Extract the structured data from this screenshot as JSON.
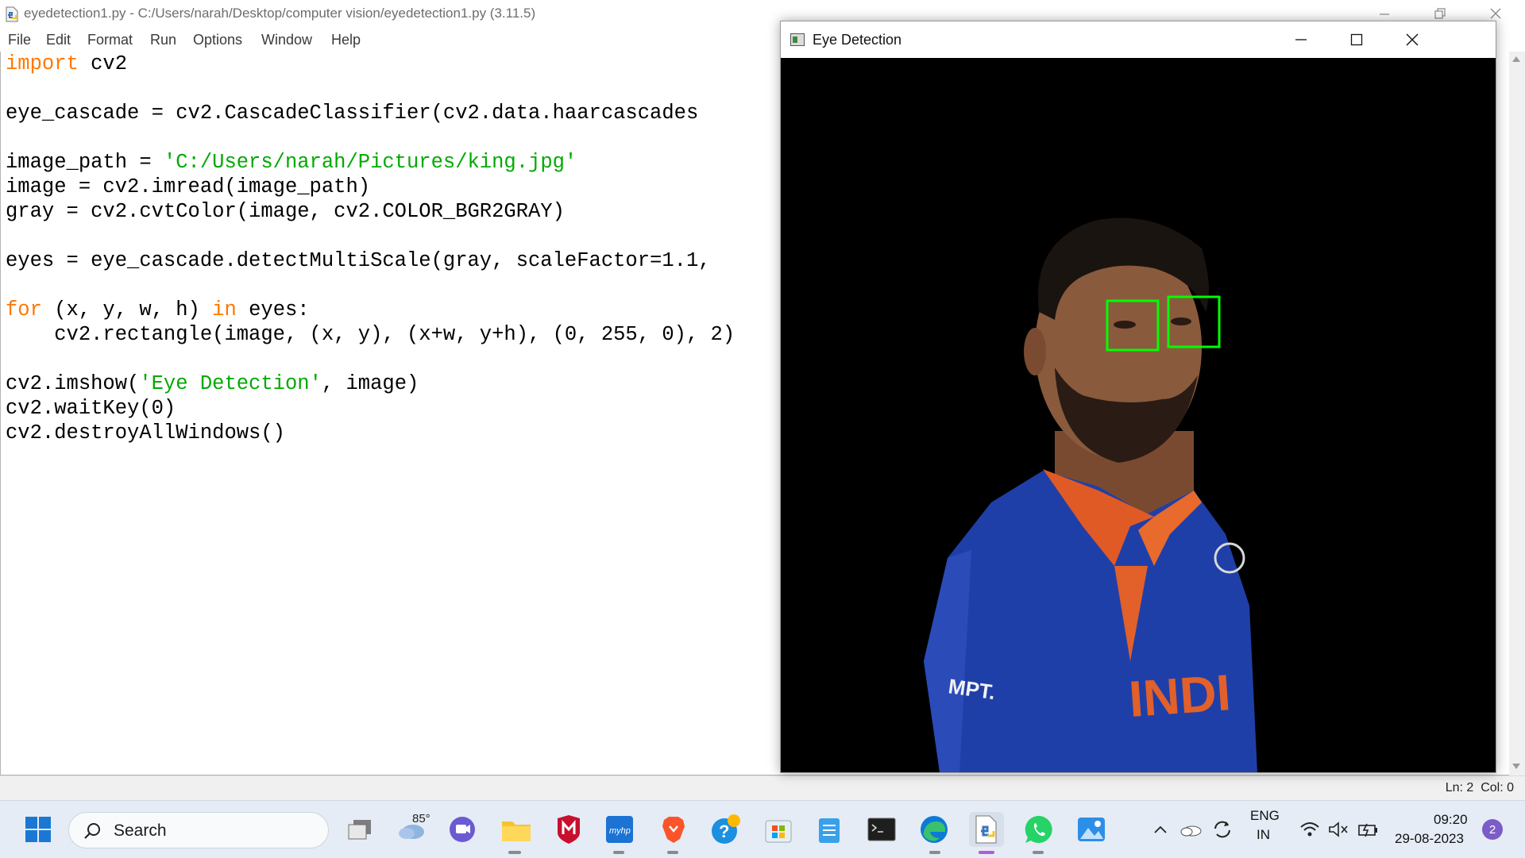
{
  "idle": {
    "title": "eyedetection1.py - C:/Users/narah/Desktop/computer vision/eyedetection1.py (3.11.5)",
    "menu": [
      "File",
      "Edit",
      "Format",
      "Run",
      "Options",
      "Window",
      "Help"
    ],
    "code_lines": [
      [
        {
          "t": "import",
          "c": "kw"
        },
        {
          "t": " cv2"
        }
      ],
      [],
      [
        {
          "t": "eye_cascade = cv2.CascadeClassifier(cv2.data.haarcascades"
        }
      ],
      [],
      [
        {
          "t": "image_path = "
        },
        {
          "t": "'C:/Users/narah/Pictures/king.jpg'",
          "c": "str"
        }
      ],
      [
        {
          "t": "image = cv2.imread(image_path)"
        }
      ],
      [
        {
          "t": "gray = cv2.cvtColor(image, cv2.COLOR_BGR2GRAY)"
        }
      ],
      [],
      [
        {
          "t": "eyes = eye_cascade.detectMultiScale(gray, scaleFactor=1.1,"
        }
      ],
      [],
      [
        {
          "t": "for",
          "c": "kw"
        },
        {
          "t": " (x, y, w, h) "
        },
        {
          "t": "in",
          "c": "kw"
        },
        {
          "t": " eyes:"
        }
      ],
      [
        {
          "t": "    cv2.rectangle(image, (x, y), (x+w, y+h), (0, 255, 0), 2)"
        }
      ],
      [],
      [
        {
          "t": "cv2.imshow("
        },
        {
          "t": "'Eye Detection'",
          "c": "str"
        },
        {
          "t": ", image)"
        }
      ],
      [
        {
          "t": "cv2.waitKey(0)"
        }
      ],
      [
        {
          "t": "cv2.destroyAllWindows()"
        }
      ]
    ],
    "status": "Ln: 2  Col: 0",
    "colors": {
      "keyword": "#ff7700",
      "string": "#00aa00"
    }
  },
  "eye_window": {
    "title": "Eye Detection",
    "box_color": "#00ff00"
  },
  "taskbar": {
    "search_label": "Search",
    "weather_temp": "85°",
    "language": "ENG",
    "region": "IN",
    "time": "09:20",
    "date": "29-08-2023",
    "notification_count": "2"
  }
}
